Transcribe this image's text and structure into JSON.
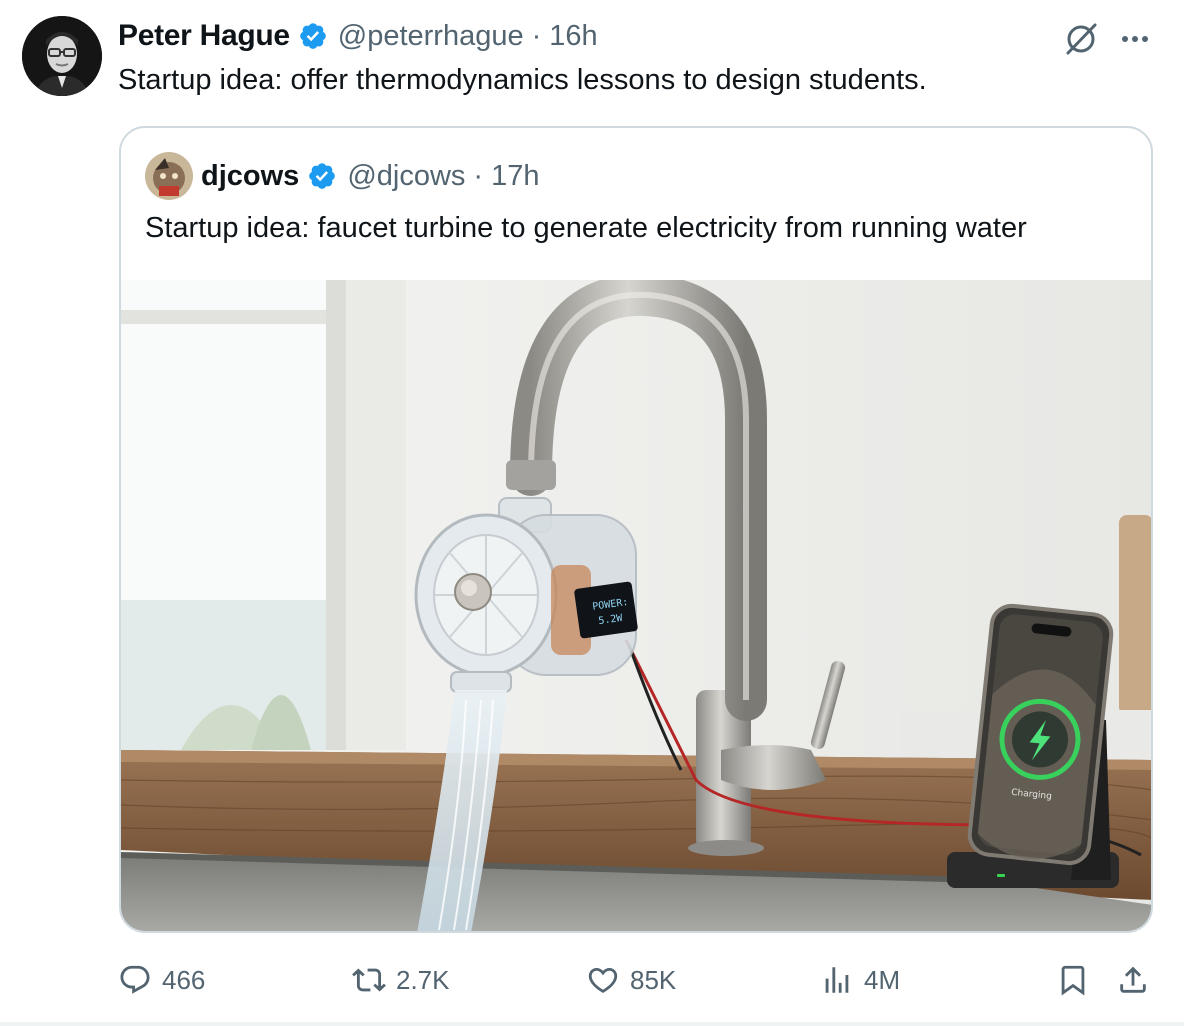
{
  "author": {
    "name": "Peter Hague",
    "handle": "@peterrhague",
    "separator": "·",
    "time": "16h",
    "text": "Startup idea: offer thermodynamics lessons to design students."
  },
  "quoted": {
    "name": "djcows",
    "handle": "@djcows",
    "separator": "·",
    "time": "17h",
    "text": "Startup idea: faucet turbine to generate electricity from running water",
    "image": {
      "display_text_top": "POWER:",
      "display_text_bottom": "5.2W",
      "phone_status": "Charging"
    }
  },
  "actions": {
    "replies": "466",
    "reposts": "2.7K",
    "likes": "85K",
    "views": "4M"
  },
  "icons": {
    "verified": "verified-badge-icon",
    "grok": "grok-icon",
    "more": "more-icon",
    "reply": "reply-icon",
    "repost": "repost-icon",
    "like": "heart-icon",
    "views": "views-icon",
    "bookmark": "bookmark-icon",
    "share": "share-icon"
  },
  "colors": {
    "verified": "#1d9bf0",
    "secondary_text": "#536471",
    "border": "#cfd9de"
  }
}
